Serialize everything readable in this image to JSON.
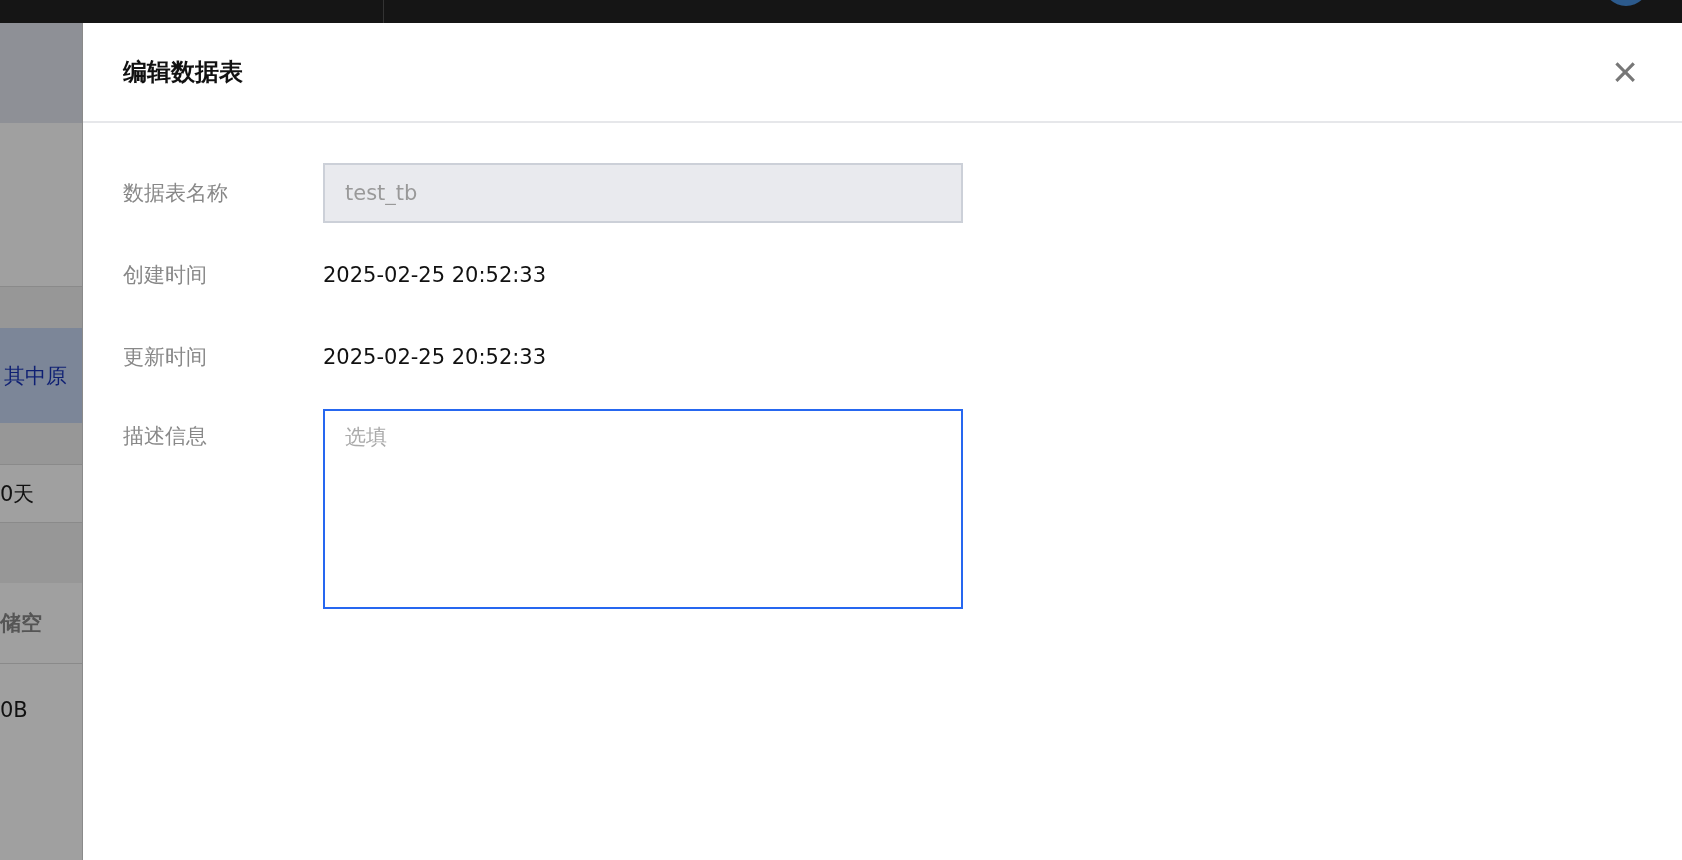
{
  "background": {
    "cells": [
      {
        "text": "其中原",
        "kind": "link"
      },
      {
        "text": "0天",
        "kind": "value"
      },
      {
        "text": "储空",
        "kind": "heading"
      },
      {
        "text": "0B",
        "kind": "value"
      }
    ]
  },
  "drawer": {
    "title": "编辑数据表",
    "close": "×",
    "fields": [
      {
        "label": "数据表名称",
        "kind": "input",
        "value": "test_tb",
        "disabled": true
      },
      {
        "label": "创建时间",
        "kind": "text",
        "value": "2025-02-25 20:52:33"
      },
      {
        "label": "更新时间",
        "kind": "text",
        "value": "2025-02-25 20:52:33"
      },
      {
        "label": "描述信息",
        "kind": "textarea",
        "placeholder": "选填",
        "focused": true
      }
    ]
  }
}
